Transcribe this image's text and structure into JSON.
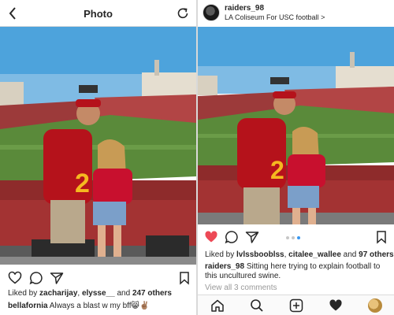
{
  "left": {
    "header": {
      "title": "Photo",
      "back_icon": "chevron-left-icon",
      "refresh_icon": "refresh-icon"
    },
    "actions": {
      "icons": [
        "heart-icon",
        "comment-icon",
        "send-icon",
        "bookmark-icon"
      ]
    },
    "likes": {
      "prefix": "Liked by ",
      "user1": "zacharijay",
      "sep1": ", ",
      "user2": "elysse__",
      "mid": " and ",
      "count": "247 others"
    },
    "caption": {
      "username": "bellafornia",
      "text": "  Always a blast w my bff😸✌🏽"
    }
  },
  "right": {
    "header": {
      "username": "raiders_98",
      "location": "LA Coliseum For USC football",
      "location_chevron": ">"
    },
    "actions": {
      "icons": [
        "heart-icon-filled",
        "comment-icon",
        "send-icon",
        "bookmark-icon"
      ],
      "heart_color": "#ed4956"
    },
    "carousel": {
      "dots": 3,
      "active": 2
    },
    "likes": {
      "prefix": "Liked by ",
      "user1": "lvlssbooblss",
      "sep1": ", ",
      "user2": "citalee_wallee",
      "mid": " and ",
      "count": "97 others"
    },
    "caption": {
      "username": "raiders_98",
      "text": " Sitting here trying to explain football to this uncultured swine."
    },
    "comments_link": "View all 3 comments",
    "bottom_nav": {
      "icons": [
        "home-icon",
        "search-icon",
        "add-post-icon",
        "activity-heart-icon",
        "profile-avatar-icon"
      ]
    }
  },
  "photo": {
    "jersey_number": "2",
    "colors": {
      "sky": "#4da3dc",
      "field": "#5a8a3a",
      "cardinal": "#b5121b",
      "gold": "#f5b820",
      "crowd": "#9c3a3a"
    }
  }
}
